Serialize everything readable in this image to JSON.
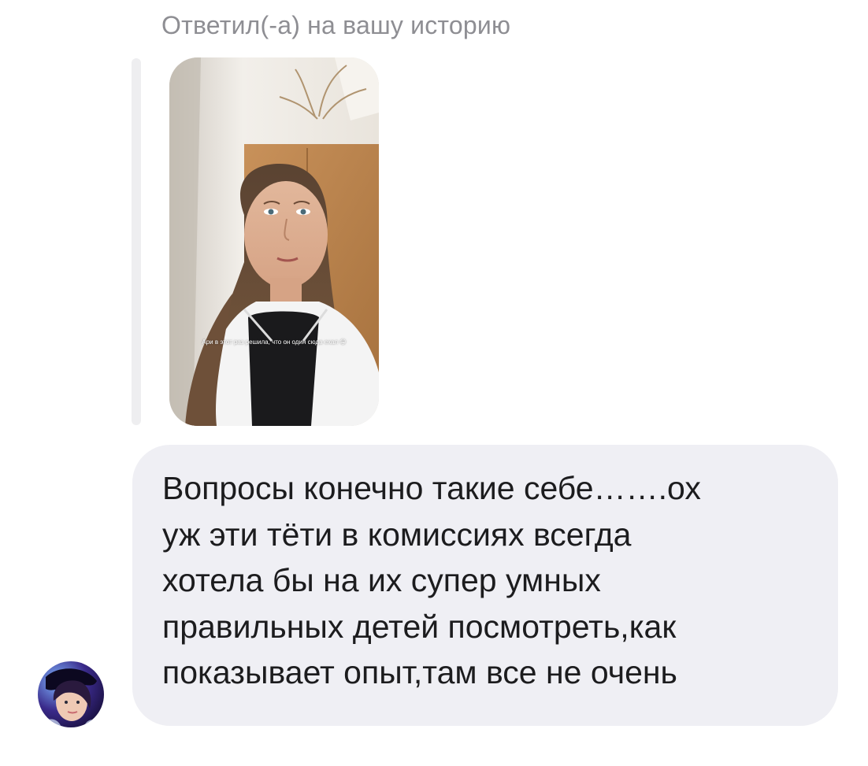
{
  "reply": {
    "header": "Ответил(-а) на вашу историю",
    "story_caption": "Ари в этот раз решила, что он один сюда ехал 😁"
  },
  "message": {
    "text": "Вопросы конечно такие себе…….ох\nуж эти тёти в комиссиях всегда\nхотела бы на их супер умных\nправильных детей посмотреть,как\nпоказывает опыт,там все не очень"
  },
  "sender": {
    "avatar": "user-avatar-icon"
  },
  "colors": {
    "bubble_bg": "#efeff4",
    "header_text": "#8e8e93",
    "message_text": "#1c1c1e",
    "reply_bar": "#eeeef0"
  }
}
